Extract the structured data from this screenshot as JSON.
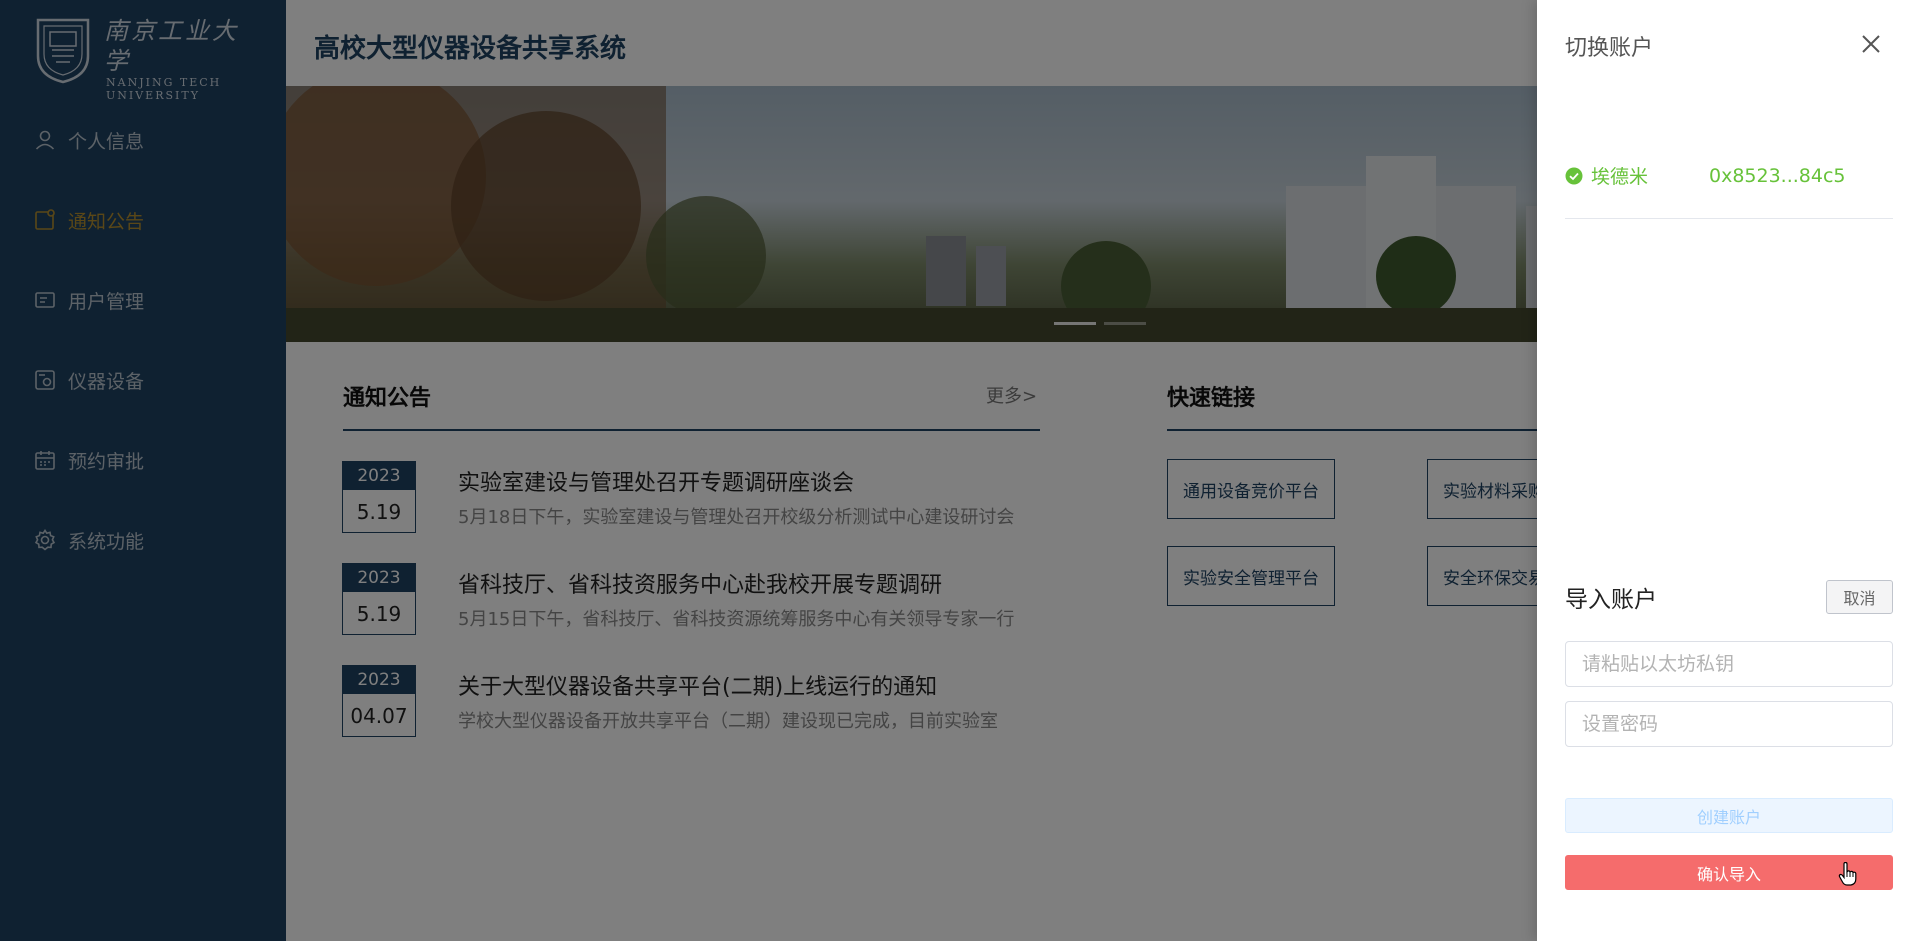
{
  "sidebar": {
    "logo": {
      "cn": "南京工业大学",
      "en_line1": "NANJING TECH",
      "en_line2": "UNIVERSITY"
    },
    "items": [
      {
        "label": "个人信息",
        "icon": "user-icon",
        "active": false
      },
      {
        "label": "通知公告",
        "icon": "notice-icon",
        "active": true
      },
      {
        "label": "用户管理",
        "icon": "id-card-icon",
        "active": false
      },
      {
        "label": "仪器设备",
        "icon": "device-icon",
        "active": false
      },
      {
        "label": "预约审批",
        "icon": "calendar-icon",
        "active": false
      },
      {
        "label": "系统功能",
        "icon": "gear-icon",
        "active": false
      }
    ]
  },
  "header": {
    "title": "高校大型仪器设备共享系统"
  },
  "notices": {
    "title": "通知公告",
    "more": "更多>",
    "items": [
      {
        "year": "2023",
        "day": "5.19",
        "title": "实验室建设与管理处召开专题调研座谈会",
        "desc": "5月18日下午，实验室建设与管理处召开校级分析测试中心建设研讨会"
      },
      {
        "year": "2023",
        "day": "5.19",
        "title": "省科技厅、省科技资服务中心赴我校开展专题调研",
        "desc": "5月15日下午，省科技厅、省科技资源统筹服务中心有关领导专家一行"
      },
      {
        "year": "2023",
        "day": "04.07",
        "title": "关于大型仪器设备共享平台(二期)上线运行的通知",
        "desc": "学校大型仪器设备开放共享平台（二期）建设现已完成，目前实验室"
      }
    ]
  },
  "quick_links": {
    "title": "快速链接",
    "items": [
      "通用设备竞价平台",
      "实验材料采购平台",
      "实验安全管理平台",
      "安全环保交易平台"
    ]
  },
  "drawer": {
    "title": "切换账户",
    "account": {
      "name": "埃德米",
      "address": "0x8523...84c5"
    },
    "import_title": "导入账户",
    "cancel_label": "取消",
    "private_key_placeholder": "请粘贴以太坊私钥",
    "password_placeholder": "设置密码",
    "create_label": "创建账户",
    "confirm_label": "确认导入"
  },
  "colors": {
    "sidebar_bg": "#1f4262",
    "active_menu": "#b48f2f",
    "success_green": "#67c23a",
    "danger_red": "#f56c6c"
  }
}
